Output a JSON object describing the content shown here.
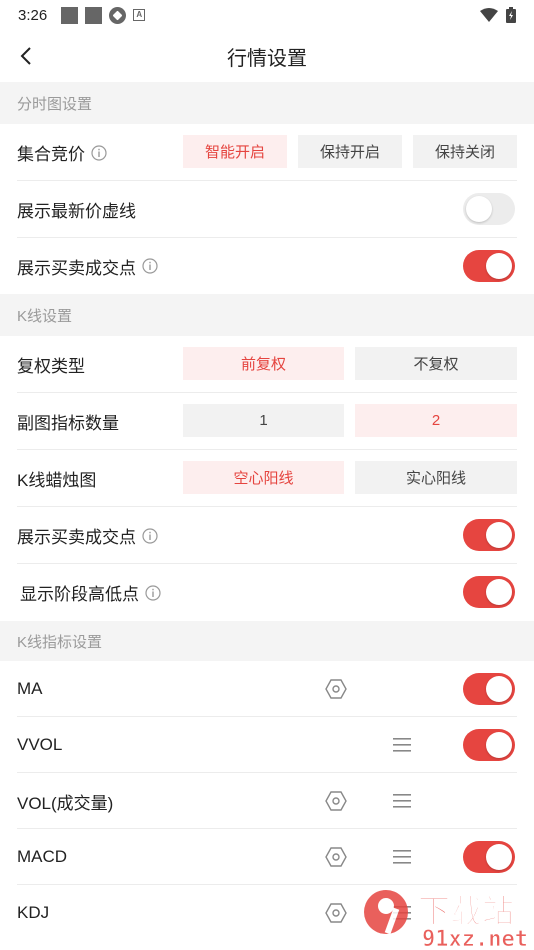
{
  "status_bar": {
    "time": "3:26"
  },
  "header": {
    "title": "行情设置"
  },
  "sections": {
    "timeshare": "分时图设置",
    "kline": "K线设置",
    "indicators": "K线指标设置"
  },
  "timeshare": {
    "auction": {
      "label": "集合竞价",
      "options": [
        "智能开启",
        "保持开启",
        "保持关闭"
      ],
      "selected": "智能开启"
    },
    "latest_price_line": {
      "label": "展示最新价虚线",
      "enabled": false
    },
    "trade_points": {
      "label": "展示买卖成交点",
      "enabled": true
    }
  },
  "kline": {
    "adjust_type": {
      "label": "复权类型",
      "options": [
        "前复权",
        "不复权"
      ],
      "selected": "前复权"
    },
    "sub_chart_count": {
      "label": "副图指标数量",
      "options": [
        "1",
        "2"
      ],
      "selected": "2"
    },
    "candle_style": {
      "label": "K线蜡烛图",
      "options": [
        "空心阳线",
        "实心阳线"
      ],
      "selected": "空心阳线"
    },
    "trade_points": {
      "label": "展示买卖成交点",
      "enabled": true
    },
    "high_low_points": {
      "label": "显示阶段高低点",
      "enabled": true
    }
  },
  "indicators": [
    {
      "name": "MA",
      "settings": true,
      "draggable": false,
      "enabled": true
    },
    {
      "name": "VVOL",
      "settings": false,
      "draggable": true,
      "enabled": true
    },
    {
      "name": "VOL(成交量)",
      "settings": true,
      "draggable": true,
      "enabled": null
    },
    {
      "name": "MACD",
      "settings": true,
      "draggable": true,
      "enabled": true
    },
    {
      "name": "KDJ",
      "settings": true,
      "draggable": true,
      "enabled": null
    }
  ],
  "watermark": {
    "brand": "下载站",
    "domain": "91xz.net"
  },
  "colors": {
    "accent": "#e64540",
    "selected_bg": "#fdeeee",
    "section_bg": "#f4f4f4",
    "toggle_off": "#ececec"
  },
  "icons": {
    "back": "chevron-left-icon",
    "info": "info-icon",
    "settings": "hexagon-settings-icon",
    "drag": "drag-handle-icon"
  }
}
